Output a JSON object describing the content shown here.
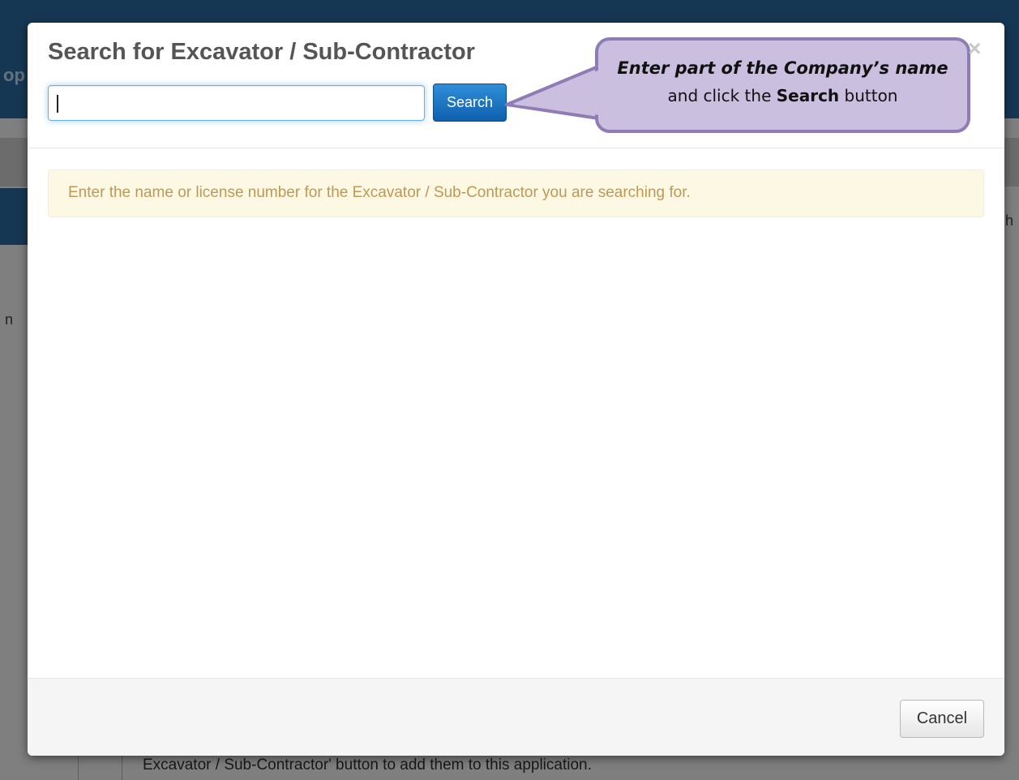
{
  "background": {
    "left_fragment": "op",
    "right_fragment_h": "h",
    "left_fragment_n": "n",
    "bottom_text": "Excavator / Sub-Contractor' button to add them to this application."
  },
  "modal": {
    "title": "Search for Excavator / Sub-Contractor",
    "search_input": {
      "value": "",
      "placeholder": ""
    },
    "search_button_label": "Search",
    "close_label": "×",
    "alert_text": "Enter the name or license number for the Excavator / Sub-Contractor you are searching for.",
    "cancel_button_label": "Cancel"
  },
  "callout": {
    "line1": "Enter part of the Company’s name",
    "line2_prefix": "and click the ",
    "line2_bold": "Search",
    "line2_suffix": " button"
  },
  "colors": {
    "primary_button": "#0f5fae",
    "alert_bg": "#fcf8e3",
    "alert_text": "#c09853",
    "callout_bg": "#cbbfe0",
    "callout_border": "#8f7cb6"
  }
}
